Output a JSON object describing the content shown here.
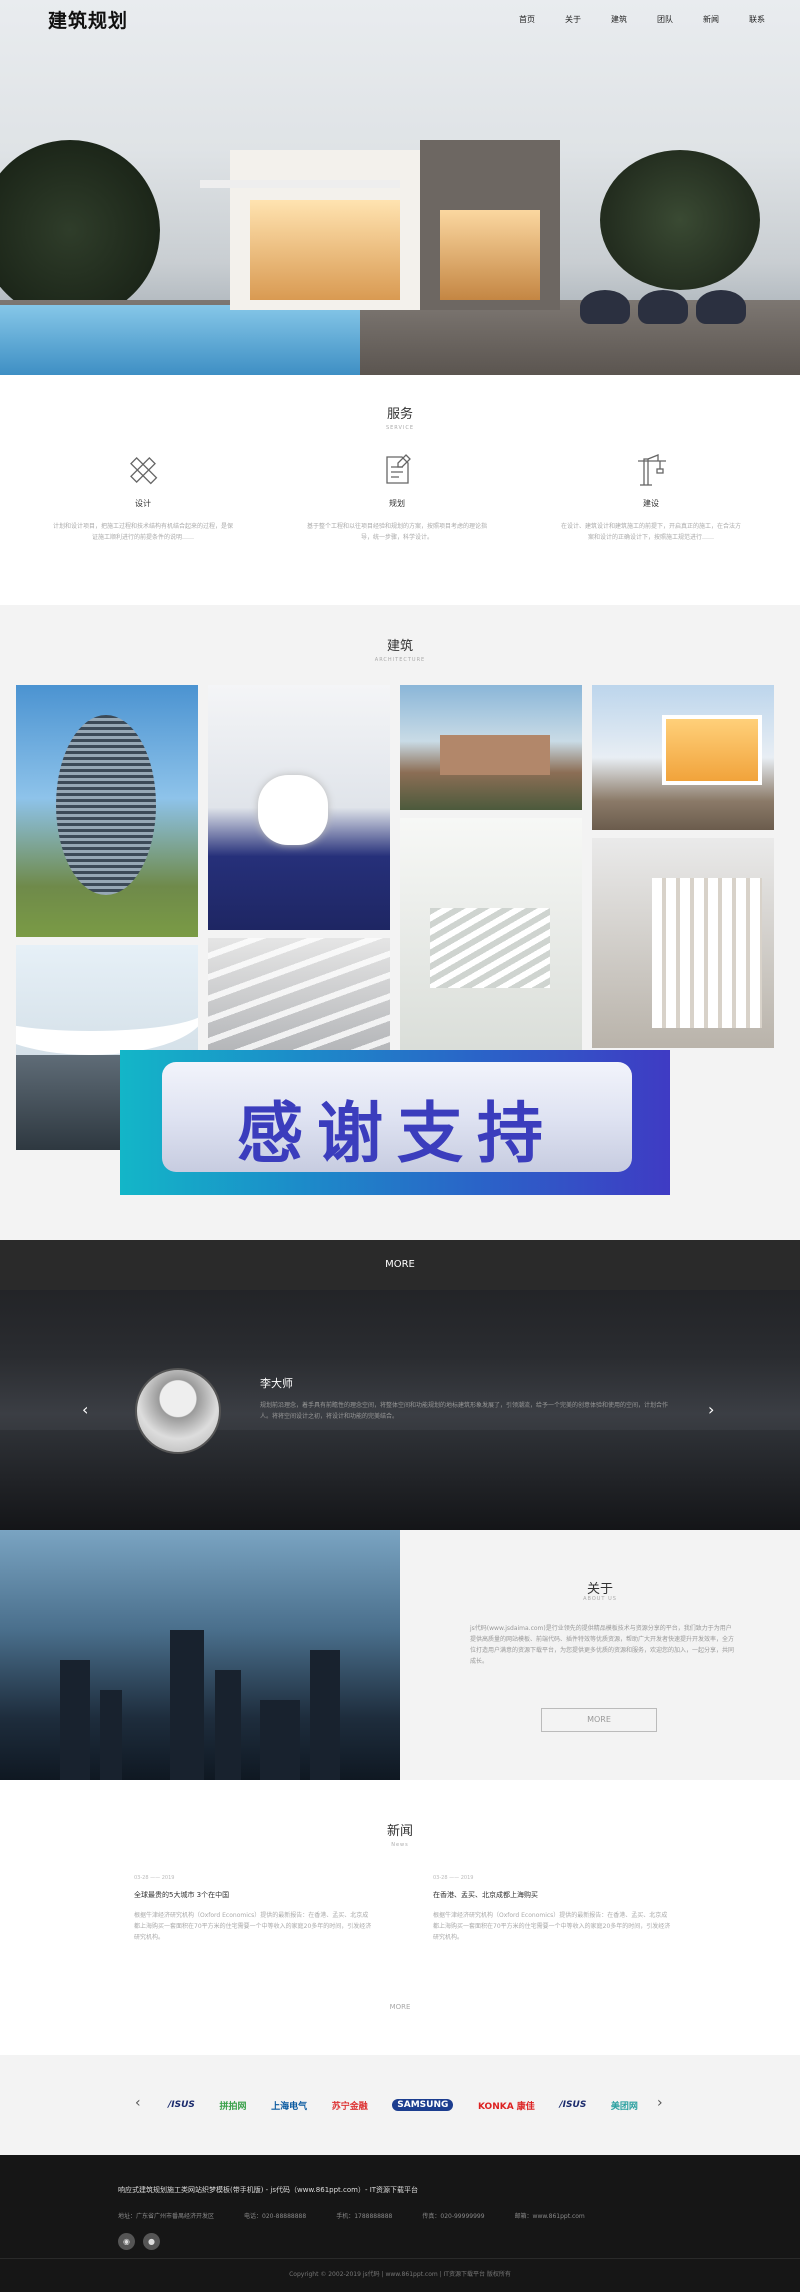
{
  "brand": {
    "logo": "建筑规划"
  },
  "nav": [
    "首页",
    "关于",
    "建筑",
    "团队",
    "新闻",
    "联系"
  ],
  "services": {
    "title": "服务",
    "subtitle": "SERVICE",
    "items": [
      {
        "name": "设计",
        "icon": "pencil-ruler-icon",
        "desc": "计划和设计项目，把施工过程和技术结构有机结合起来的过程，是保证施工顺利进行的前提条件的说明……"
      },
      {
        "name": "规划",
        "icon": "document-icon",
        "desc": "基于整个工程和以往项目经验和规划的方案，按照项目考虑的理论指导，统一步骤，科学设计。"
      },
      {
        "name": "建设",
        "icon": "crane-icon",
        "desc": "在设计、建筑设计和建筑施工的前提下，开启真正的施工，在合法方案和设计的正确设计下，按照施工规范进行……"
      }
    ]
  },
  "architecture": {
    "title": "建筑",
    "subtitle": "ARCHITECTURE"
  },
  "banner": {
    "text": "感谢支持"
  },
  "team": {
    "more": "MORE",
    "name": "李大师",
    "bio": "规划前沿理念，着手具有前瞻性的理念空间，将整体空间和功能规划的地标建筑形象发展了，引领潮流，给予一个完美的创意体验和使用的空间，计划合作人。将将空间设计之初，将设计和功能的完美结合。",
    "prev": "‹",
    "next": "›"
  },
  "about": {
    "title": "关于",
    "subtitle": "ABOUT US",
    "text": "js代码(www.jsdaima.com)是行业领先的提供精品模板技术与资源分享的平台，我们致力于为用户提供高质量的网站模板、前端代码、插件特效等优质资源，帮助广大开发者快速提升开发效率，全方位打造用户满意的资源下载平台，为您提供更多优质的资源和服务，欢迎您的加入，一起分享，共同成长。",
    "button": "MORE"
  },
  "news": {
    "title": "新闻",
    "subtitle": "News",
    "items": [
      {
        "date": "03-28 —— 2019",
        "title": "全球最贵的5大城市 3个在中国",
        "desc": "根据牛津经济研究机构（Oxford Economics）提供的最新报告：在香港、孟买、北京成都上海购买一套面积在70平方米的住宅需要一个中等收入的家庭20多年的时间，引发经济研究机构。"
      },
      {
        "date": "03-28 —— 2019",
        "title": "在香港、孟买、北京成都上海购买",
        "desc": "根据牛津经济研究机构（Oxford Economics）提供的最新报告：在香港、孟买、北京成都上海购买一套面积在70平方米的住宅需要一个中等收入的家庭20多年的时间，引发经济研究机构。"
      }
    ],
    "more": "MORE"
  },
  "partners": [
    "/ISUS",
    "拼拍网",
    "上海电气",
    "苏宁金融",
    "SAMSUNG",
    "KONKA 康佳",
    "/ISUS",
    "美团网"
  ],
  "partners_nav": {
    "prev": "‹",
    "next": "›"
  },
  "footer": {
    "line1": "响应式建筑规划施工类网站织梦模板(带手机版) - js代码（www.861ppt.com）- IT资源下载平台",
    "address": "地址：广东省广州市番禺经济开发区",
    "phone": "电话：020-88888888",
    "mobile": "手机：1788888888",
    "fax": "传真：020-99999999",
    "site": "邮箱：www.861ppt.com",
    "copyright": "Copyright © 2002-2019 js代码 | www.861ppt.com | IT资源下载平台 版权所有"
  }
}
